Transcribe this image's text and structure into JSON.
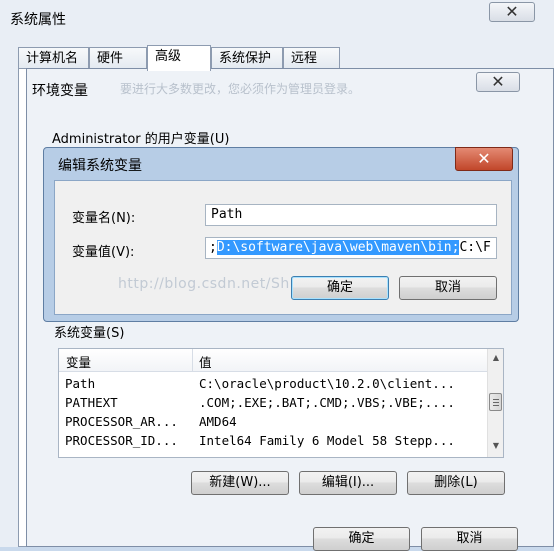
{
  "outer_window": {
    "title": "系统属性",
    "close": "✕",
    "tabs": [
      "计算机名",
      "硬件",
      "高级",
      "系统保护",
      "远程"
    ]
  },
  "env_window": {
    "title": "环境变量",
    "title_ghost": "要进行大多数更改，您必须作为管理员登录。",
    "close": "✕",
    "user_vars_label": "Administrator 的用户变量(U)",
    "system_vars_label": "系统变量(S)",
    "columns": [
      "变量",
      "值"
    ],
    "rows": [
      {
        "name": "Path",
        "value": "C:\\oracle\\product\\10.2.0\\client..."
      },
      {
        "name": "PATHEXT",
        "value": ".COM;.EXE;.BAT;.CMD;.VBS;.VBE;...."
      },
      {
        "name": "PROCESSOR_AR...",
        "value": "AMD64"
      },
      {
        "name": "PROCESSOR_ID...",
        "value": "Intel64 Family 6 Model 58 Stepp..."
      }
    ],
    "buttons": {
      "new": "新建(W)...",
      "edit": "编辑(I)...",
      "delete": "删除(L)"
    },
    "footer_buttons": {
      "ok": "确定",
      "cancel": "取消"
    }
  },
  "edit_dialog": {
    "title": "编辑系统变量",
    "close": "✕",
    "name_label": "变量名(N):",
    "name_value": "Path",
    "value_label": "变量值(V):",
    "value_before": ";",
    "value_selected": "D:\\software\\java\\web\\maven\\bin;",
    "value_after": "C:\\F",
    "ok": "确定",
    "cancel": "取消"
  },
  "watermark": "http://blog.csdn.net/ShiXiaoShi"
}
